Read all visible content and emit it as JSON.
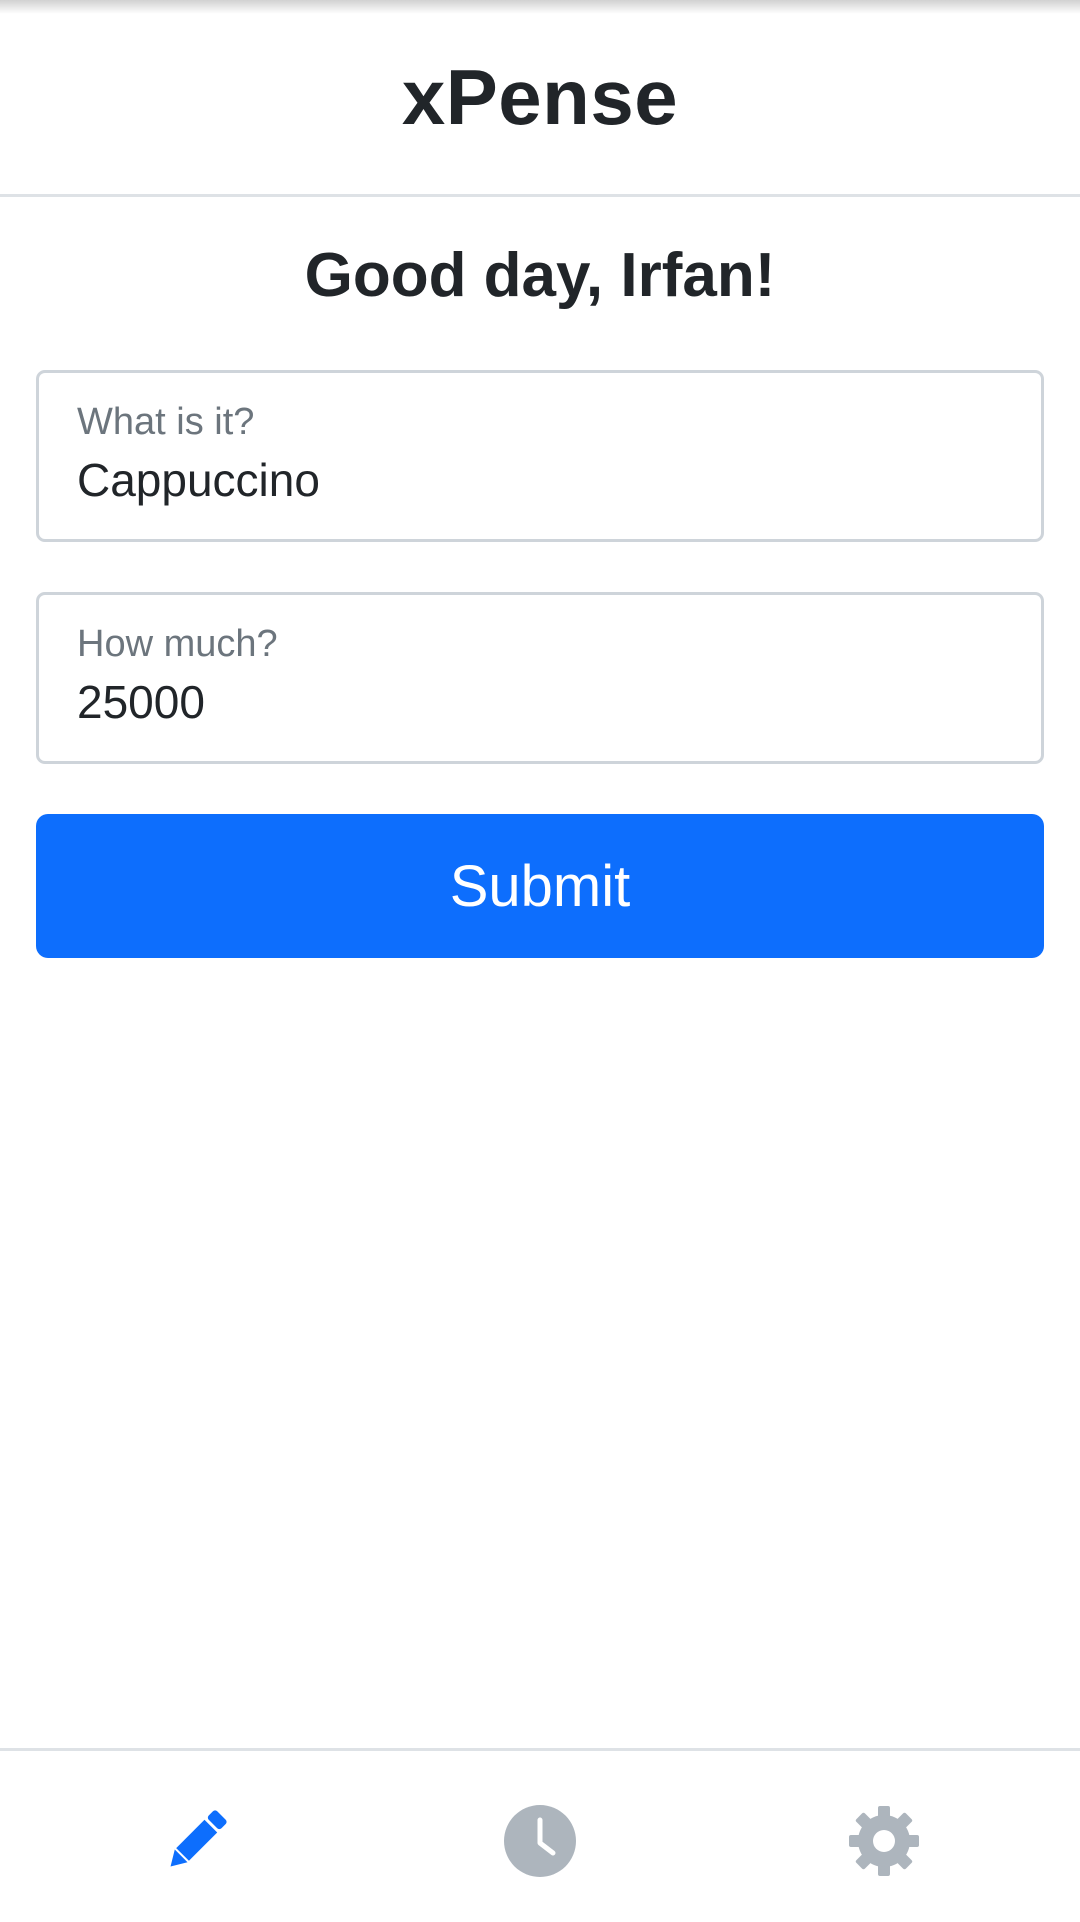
{
  "header": {
    "title": "xPense"
  },
  "main": {
    "greeting": "Good day, Irfan!",
    "fields": {
      "what": {
        "label": "What is it?",
        "value": "Cappuccino"
      },
      "how_much": {
        "label": "How much?",
        "value": "25000"
      }
    },
    "submit_label": "Submit"
  },
  "bottom_nav": {
    "items": [
      {
        "icon": "pencil-icon",
        "active": true
      },
      {
        "icon": "clock-icon",
        "active": false
      },
      {
        "icon": "gear-icon",
        "active": false
      }
    ]
  },
  "colors": {
    "accent": "#0d6efd",
    "inactive_icon": "#adb5bd",
    "text": "#212529",
    "muted_text": "#6c757d",
    "border": "#ced4da"
  }
}
